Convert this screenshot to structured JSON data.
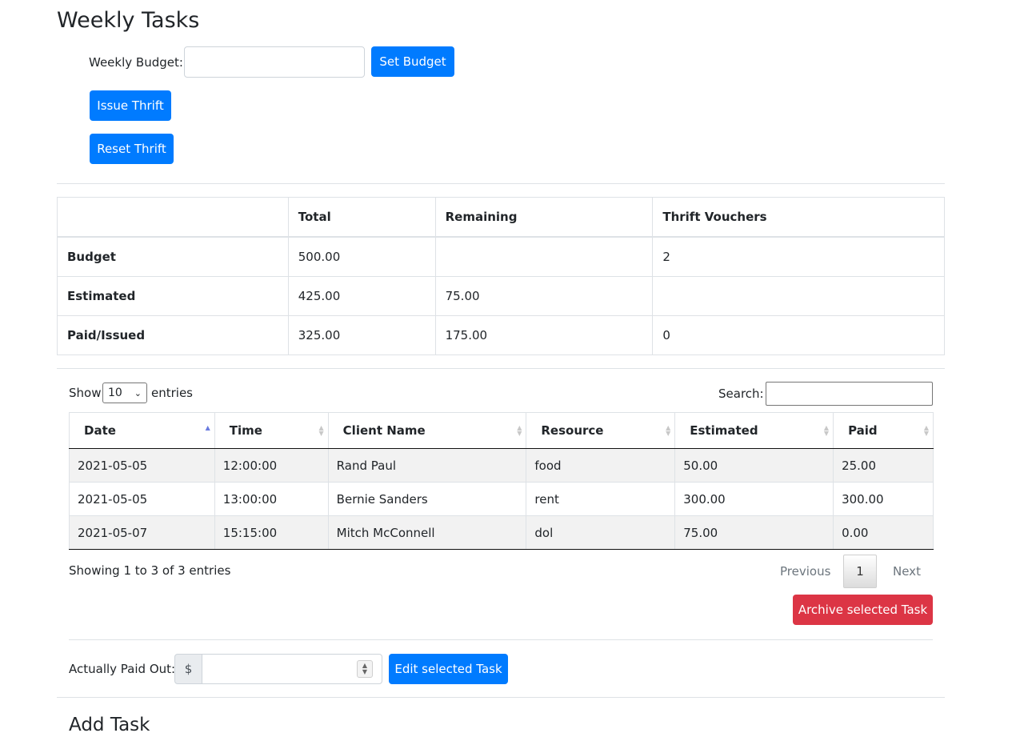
{
  "page": {
    "title": "Weekly Tasks",
    "add_title": "Add Task"
  },
  "budget": {
    "label": "Weekly Budget:",
    "input_value": "",
    "set_label": "Set Budget",
    "issue_label": "Issue Thrift",
    "reset_label": "Reset Thrift"
  },
  "summary": {
    "headers": [
      "",
      "Total",
      "Remaining",
      "Thrift Vouchers"
    ],
    "rows": [
      {
        "label": "Budget",
        "total": "500.00",
        "remaining": "",
        "vouchers": "2"
      },
      {
        "label": "Estimated",
        "total": "425.00",
        "remaining": "75.00",
        "vouchers": ""
      },
      {
        "label": "Paid/Issued",
        "total": "325.00",
        "remaining": "175.00",
        "vouchers": "0"
      }
    ]
  },
  "datatable": {
    "show_label": "Show",
    "entries_label": "entries",
    "length_value": "10",
    "search_label": "Search:",
    "search_value": "",
    "columns": [
      "Date",
      "Time",
      "Client Name",
      "Resource",
      "Estimated",
      "Paid"
    ],
    "rows": [
      [
        "2021-05-05",
        "12:00:00",
        "Rand Paul",
        "food",
        "50.00",
        "25.00"
      ],
      [
        "2021-05-05",
        "13:00:00",
        "Bernie Sanders",
        "rent",
        "300.00",
        "300.00"
      ],
      [
        "2021-05-07",
        "15:15:00",
        "Mitch McConnell",
        "dol",
        "75.00",
        "0.00"
      ]
    ],
    "info": "Showing 1 to 3 of 3 entries",
    "prev": "Previous",
    "page": "1",
    "next": "Next",
    "archive_label": "Archive selected Task"
  },
  "edit": {
    "label": "Actually Paid Out:",
    "currency": "$",
    "input_value": "",
    "button_label": "Edit selected Task"
  },
  "colors": {
    "primary": "#007bff",
    "danger": "#dc3545",
    "border": "#dee2e6"
  },
  "icons": {
    "sort": "sort-arrows-icon",
    "select": "chevron-down-icon",
    "spin": "spinner-arrows-icon"
  }
}
